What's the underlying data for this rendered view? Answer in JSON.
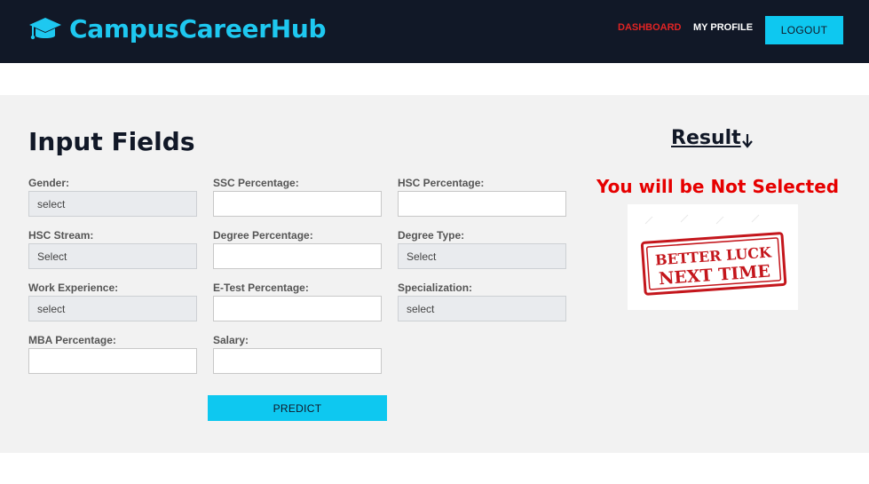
{
  "navbar": {
    "brand": "CampusCareerHub",
    "links": {
      "dashboard": "DASHBOARD",
      "profile": "MY PROFILE"
    },
    "logout_label": "LOGOUT",
    "colors": {
      "bg": "#111827",
      "brand": "#1ec8f0",
      "active_link": "#e02424"
    }
  },
  "form": {
    "title": "Input Fields",
    "fields": {
      "gender": {
        "label": "Gender:",
        "value": "select"
      },
      "ssc": {
        "label": "SSC Percentage:",
        "value": ""
      },
      "hsc": {
        "label": "HSC Percentage:",
        "value": ""
      },
      "hsc_stream": {
        "label": "HSC Stream:",
        "value": "Select"
      },
      "degree": {
        "label": "Degree Percentage:",
        "value": ""
      },
      "degree_type": {
        "label": "Degree Type:",
        "value": "Select"
      },
      "work_exp": {
        "label": "Work Experience:",
        "value": "select"
      },
      "etest": {
        "label": "E-Test Percentage:",
        "value": ""
      },
      "specialization": {
        "label": "Specialization:",
        "value": "select"
      },
      "mba": {
        "label": "MBA Percentage:",
        "value": ""
      },
      "salary": {
        "label": "Salary:",
        "value": ""
      }
    },
    "predict_label": "PREDICT"
  },
  "result": {
    "title": "Result",
    "arrow_icon": "arrow-down-icon",
    "message": "You will be Not Selected",
    "stamp": {
      "line1": "BETTER LUCK",
      "line2": "NEXT TIME"
    },
    "message_color": "#e60000"
  }
}
